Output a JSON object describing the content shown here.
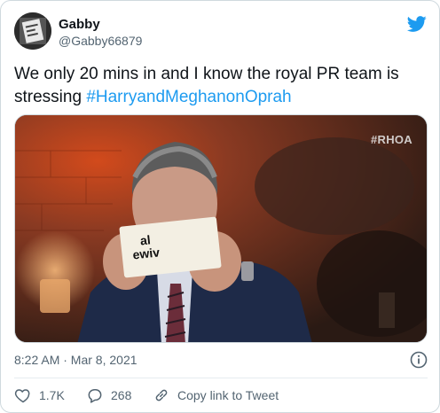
{
  "author": {
    "name": "Gabby",
    "handle": "@Gabby66879"
  },
  "tweet": {
    "text_before": "We only 20 mins in and I know the royal PR team is stressing ",
    "hashtag": "#HarryandMeghanonOprah"
  },
  "media": {
    "watermark": "#RHOA",
    "card_text": "al\newiv"
  },
  "meta": {
    "timestamp": "8:22 AM · Mar 8, 2021"
  },
  "actions": {
    "like_count": "1.7K",
    "reply_count": "268",
    "copy_label": "Copy link to Tweet"
  },
  "icons": {
    "brand": "twitter-bird-icon",
    "info": "info-icon",
    "like": "heart-icon",
    "reply": "reply-bubble-icon",
    "copy": "link-icon"
  },
  "colors": {
    "accent": "#1d9bf0",
    "text": "#0f1419",
    "secondary": "#536471"
  }
}
